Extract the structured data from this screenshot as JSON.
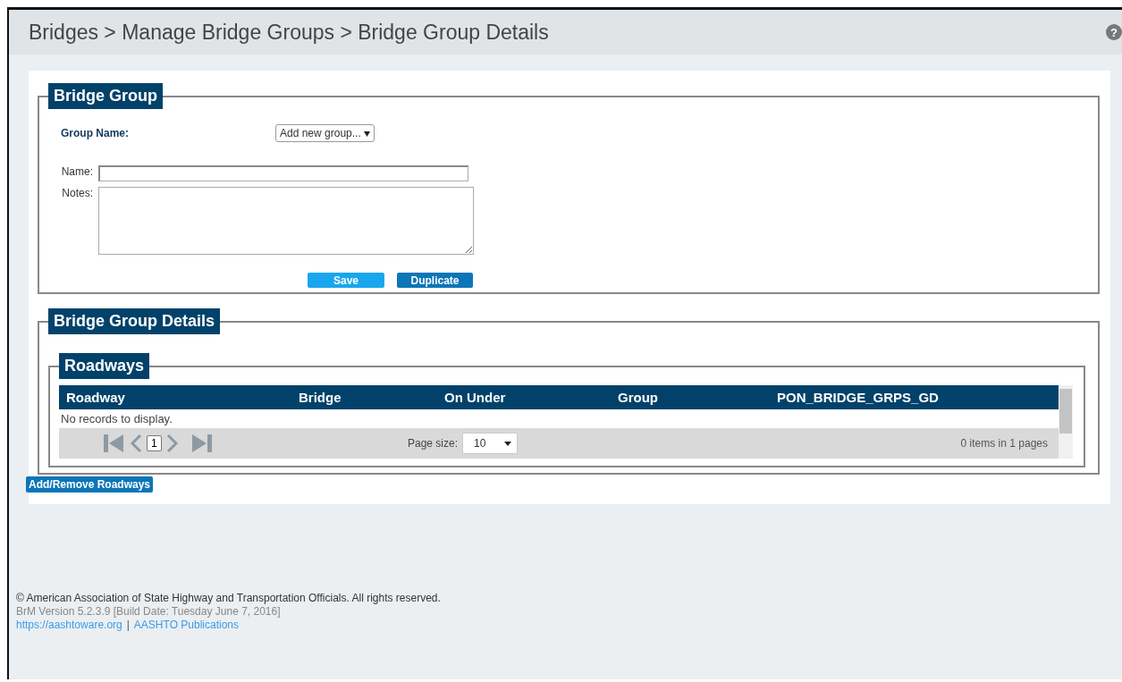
{
  "header": {
    "breadcrumb": "Bridges > Manage Bridge Groups > Bridge Group Details",
    "help": "?"
  },
  "bridge_group": {
    "legend": "Bridge Group",
    "group_name_label": "Group Name:",
    "group_select": "Add new group...",
    "name_label": "Name:",
    "notes_label": "Notes:",
    "buttons": [
      "Save",
      "Duplicate"
    ]
  },
  "details": {
    "legend": "Bridge Group Details",
    "roadways": {
      "legend": "Roadways",
      "columns": [
        "Roadway",
        "Bridge",
        "On Under",
        "Group",
        "PON_BRIDGE_GRPS_GD"
      ],
      "empty_message": "No records to display.",
      "page": "1",
      "page_size_label": "Page size:",
      "page_size": "10",
      "summary": "0 items in 1 pages"
    },
    "add_button": "Add/Remove Roadways"
  },
  "footer": {
    "copyright": "© American Association of State Highway and Transportation Officials. All rights reserved.",
    "version": "BrM Version 5.2.3.9 [Build Date: Tuesday June 7, 2016]",
    "links": [
      "https://aashtoware.org",
      "AASHTO Publications"
    ],
    "separator": "|"
  }
}
